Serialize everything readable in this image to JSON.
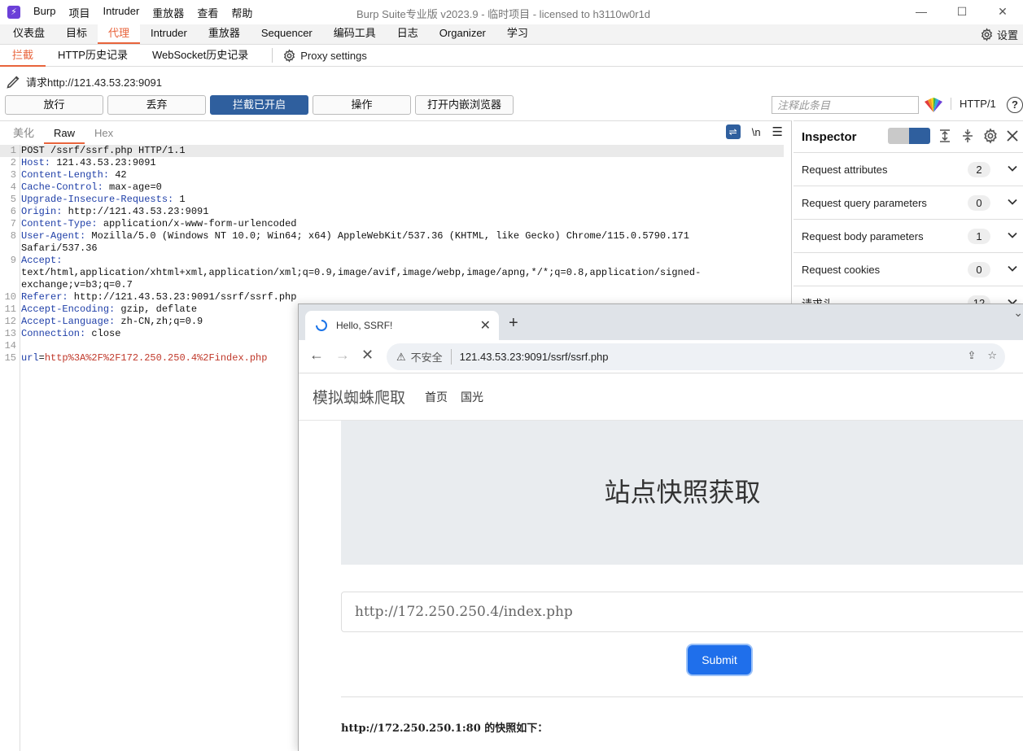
{
  "app": {
    "logo_text": "Burp",
    "title": "Burp Suite专业版  v2023.9 - 临时项目 - licensed to h3110w0r1d",
    "menu": [
      "Burp",
      "项目",
      "Intruder",
      "重放器",
      "查看",
      "帮助"
    ],
    "window_controls": [
      "—",
      "☐",
      "✕"
    ]
  },
  "main_tabs": [
    "仪表盘",
    "目标",
    "代理",
    "Intruder",
    "重放器",
    "Sequencer",
    "编码工具",
    "日志",
    "Organizer",
    "学习"
  ],
  "settings_label": "设置",
  "sub_tabs": [
    "拦截",
    "HTTP历史记录",
    "WebSocket历史记录"
  ],
  "proxy_settings_label": "Proxy settings",
  "request_line": "请求http://121.43.53.23:9091",
  "buttons": {
    "forward": "放行",
    "drop": "丢弃",
    "intercept": "拦截已开启",
    "action": "操作",
    "open_browser": "打开内嵌浏览器"
  },
  "comment_placeholder": "注释此条目",
  "http_version": "HTTP/1",
  "editor": {
    "tabs": [
      "美化",
      "Raw",
      "Hex"
    ],
    "newline_label": "\\n",
    "lines": [
      {
        "n": "1",
        "key": "",
        "val": "POST /ssrf/ssrf.php HTTP/1.1"
      },
      {
        "n": "2",
        "key": "Host:",
        "val": " 121.43.53.23:9091"
      },
      {
        "n": "3",
        "key": "Content-Length:",
        "val": " 42"
      },
      {
        "n": "4",
        "key": "Cache-Control:",
        "val": " max-age=0"
      },
      {
        "n": "5",
        "key": "Upgrade-Insecure-Requests:",
        "val": " 1"
      },
      {
        "n": "6",
        "key": "Origin:",
        "val": " http://121.43.53.23:9091"
      },
      {
        "n": "7",
        "key": "Content-Type:",
        "val": " application/x-www-form-urlencoded"
      },
      {
        "n": "8",
        "key": "User-Agent:",
        "val": " Mozilla/5.0 (Windows NT 10.0; Win64; x64) AppleWebKit/537.36 (KHTML, like Gecko) Chrome/115.0.5790.171"
      },
      {
        "n": "",
        "key": "",
        "val": "Safari/537.36"
      },
      {
        "n": "9",
        "key": "Accept:",
        "val": ""
      },
      {
        "n": "",
        "key": "",
        "val": "text/html,application/xhtml+xml,application/xml;q=0.9,image/avif,image/webp,image/apng,*/*;q=0.8,application/signed-"
      },
      {
        "n": "",
        "key": "",
        "val": "exchange;v=b3;q=0.7"
      },
      {
        "n": "10",
        "key": "Referer:",
        "val": " http://121.43.53.23:9091/ssrf/ssrf.php"
      },
      {
        "n": "11",
        "key": "Accept-Encoding:",
        "val": " gzip, deflate"
      },
      {
        "n": "12",
        "key": "Accept-Language:",
        "val": " zh-CN,zh;q=0.9"
      },
      {
        "n": "13",
        "key": "Connection:",
        "val": " close"
      },
      {
        "n": "14",
        "key": "",
        "val": ""
      },
      {
        "n": "15",
        "key": "url",
        "val": "=",
        "param": "http%3A%2F%2F172.250.250.4%2Findex.php"
      }
    ]
  },
  "inspector": {
    "title": "Inspector",
    "rows": [
      {
        "label": "Request attributes",
        "count": "2"
      },
      {
        "label": "Request query parameters",
        "count": "0"
      },
      {
        "label": "Request body parameters",
        "count": "1"
      },
      {
        "label": "Request cookies",
        "count": "0"
      },
      {
        "label": "请求头",
        "count": "12"
      }
    ]
  },
  "browser": {
    "tab_title": "Hello, SSRF!",
    "insecure_label": "不安全",
    "url": "121.43.53.23:9091/ssrf/ssrf.php",
    "site_brand": "模拟蜘蛛爬取",
    "nav_links": [
      "首页",
      "国光"
    ],
    "page_title": "站点快照获取",
    "url_value": "http://172.250.250.4/index.php",
    "submit_label": "Submit",
    "snapshot_text": "http://172.250.250.1:80 的快照如下："
  },
  "colors": {
    "accent": "#e8643c",
    "intercept_button": "#2f5f9e",
    "submit_button": "#1f6feb"
  }
}
